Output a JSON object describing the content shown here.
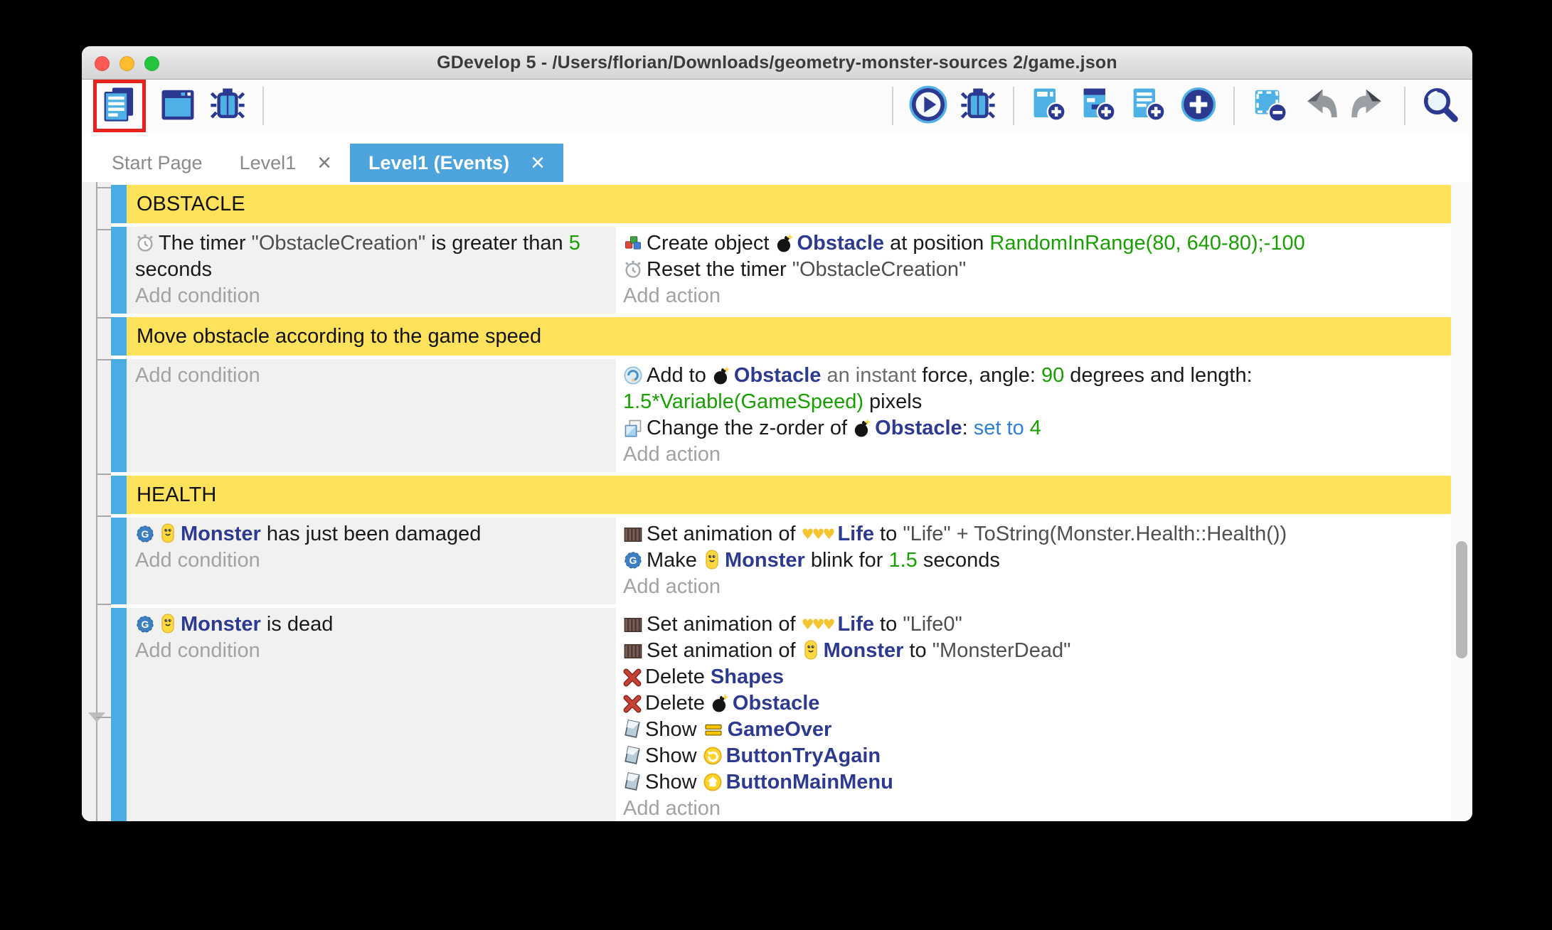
{
  "window": {
    "title": "GDevelop 5 - /Users/florian/Downloads/geometry-monster-sources 2/game.json",
    "traffic_lights": [
      "close",
      "minimize",
      "zoom"
    ]
  },
  "palette": {
    "accent_blue": "#4da3dc",
    "selection_bar_blue": "#4bace3",
    "group_header_yellow": "#ffe25c",
    "object_name_blue": "#2d3a8f",
    "expression_green": "#17a000",
    "operator_blue": "#2e7fd6",
    "annotation_highlight_red": "#e8221c"
  },
  "toolbar": {
    "left": [
      {
        "icon": "events-sheet-icon",
        "highlighted": true
      },
      {
        "icon": "scene-editor-icon"
      },
      {
        "icon": "debug-icon"
      },
      {
        "divider": true
      }
    ],
    "right": [
      {
        "divider": true
      },
      {
        "icon": "play-icon"
      },
      {
        "icon": "debug-icon"
      },
      {
        "divider": true
      },
      {
        "icon": "add-event-icon"
      },
      {
        "icon": "add-subevent-icon"
      },
      {
        "icon": "add-comment-icon"
      },
      {
        "icon": "add-circle-icon"
      },
      {
        "divider": true
      },
      {
        "icon": "remove-selection-icon"
      },
      {
        "icon": "undo-icon"
      },
      {
        "icon": "redo-icon"
      },
      {
        "divider": true
      },
      {
        "icon": "search-icon"
      }
    ]
  },
  "tabs": [
    {
      "label": "Start Page",
      "closable": false,
      "active": false
    },
    {
      "label": "Level1",
      "closable": true,
      "active": false
    },
    {
      "label": "Level1 (Events)",
      "closable": true,
      "active": true
    }
  ],
  "events": {
    "add_condition_label": "Add condition",
    "add_action_label": "Add action",
    "rows": [
      {
        "type": "group",
        "label": "OBSTACLE"
      },
      {
        "type": "event",
        "conditions": [
          {
            "segs": [
              {
                "ic": "timer"
              },
              {
                "t": "The timer ",
                "c": "plain"
              },
              {
                "t": "\"ObstacleCreation\"",
                "c": "string"
              },
              {
                "t": " is greater than ",
                "c": "plain"
              },
              {
                "t": "5",
                "c": "expr"
              },
              {
                "br": true
              },
              {
                "t": "seconds",
                "c": "plain"
              }
            ]
          },
          {
            "ph": "Add condition"
          }
        ],
        "actions": [
          {
            "segs": [
              {
                "ic": "create"
              },
              {
                "t": "Create object ",
                "c": "plain"
              },
              {
                "ic": "bomb"
              },
              {
                "t": "Obstacle",
                "c": "object"
              },
              {
                "t": " at position ",
                "c": "plain"
              },
              {
                "t": "RandomInRange(80, 640-80);-100",
                "c": "expr"
              }
            ]
          },
          {
            "segs": [
              {
                "ic": "timer"
              },
              {
                "t": "Reset the timer ",
                "c": "plain"
              },
              {
                "t": "\"ObstacleCreation\"",
                "c": "string"
              }
            ]
          },
          {
            "ph": "Add action"
          }
        ]
      },
      {
        "type": "group",
        "label": "Move obstacle according to the game speed"
      },
      {
        "type": "event",
        "conditions": [
          {
            "ph": "Add condition"
          }
        ],
        "actions": [
          {
            "segs": [
              {
                "ic": "force"
              },
              {
                "t": "Add to ",
                "c": "plain"
              },
              {
                "ic": "bomb"
              },
              {
                "t": "Obstacle",
                "c": "object"
              },
              {
                "t": " an instant ",
                "c": "gray"
              },
              {
                "t": "force, angle: ",
                "c": "plain"
              },
              {
                "t": "90",
                "c": "expr"
              },
              {
                "t": " degrees and length:",
                "c": "plain"
              },
              {
                "br": true
              },
              {
                "t": "1.5*Variable(GameSpeed)",
                "c": "expr"
              },
              {
                "t": " pixels",
                "c": "plain"
              }
            ]
          },
          {
            "segs": [
              {
                "ic": "zorder"
              },
              {
                "t": "Change the z-order of ",
                "c": "plain"
              },
              {
                "ic": "bomb"
              },
              {
                "t": "Obstacle",
                "c": "object"
              },
              {
                "t": ": ",
                "c": "plain"
              },
              {
                "t": "set to ",
                "c": "blue"
              },
              {
                "t": "4",
                "c": "expr"
              }
            ]
          },
          {
            "ph": "Add action"
          }
        ]
      },
      {
        "type": "group",
        "label": "HEALTH"
      },
      {
        "type": "event",
        "conditions": [
          {
            "segs": [
              {
                "ic": "behavior"
              },
              {
                "ic": "monster"
              },
              {
                "t": "Monster",
                "c": "object"
              },
              {
                "t": " has just been damaged",
                "c": "plain"
              }
            ]
          },
          {
            "ph": "Add condition"
          }
        ],
        "actions": [
          {
            "segs": [
              {
                "ic": "anim"
              },
              {
                "t": "Set animation of ",
                "c": "plain"
              },
              {
                "ic": "hearts"
              },
              {
                "t": "Life",
                "c": "object"
              },
              {
                "t": " to ",
                "c": "plain"
              },
              {
                "t": "\"Life\" + ToString(Monster.Health::Health())",
                "c": "string"
              }
            ]
          },
          {
            "segs": [
              {
                "ic": "behavior"
              },
              {
                "t": "Make ",
                "c": "plain"
              },
              {
                "ic": "monster"
              },
              {
                "t": "Monster",
                "c": "object"
              },
              {
                "t": " blink for ",
                "c": "plain"
              },
              {
                "t": "1.5",
                "c": "expr"
              },
              {
                "t": " seconds",
                "c": "plain"
              }
            ]
          },
          {
            "ph": "Add action"
          }
        ]
      },
      {
        "type": "event",
        "selected": true,
        "conditions": [
          {
            "segs": [
              {
                "ic": "behavior"
              },
              {
                "ic": "monster"
              },
              {
                "t": "Monster",
                "c": "object"
              },
              {
                "t": " is dead",
                "c": "plain"
              }
            ]
          },
          {
            "ph": "Add condition"
          }
        ],
        "actions": [
          {
            "segs": [
              {
                "ic": "anim"
              },
              {
                "t": "Set animation of ",
                "c": "plain"
              },
              {
                "ic": "hearts"
              },
              {
                "t": "Life",
                "c": "object"
              },
              {
                "t": " to ",
                "c": "plain"
              },
              {
                "t": "\"Life0\"",
                "c": "string"
              }
            ]
          },
          {
            "segs": [
              {
                "ic": "anim"
              },
              {
                "t": "Set animation of ",
                "c": "plain"
              },
              {
                "ic": "monster"
              },
              {
                "t": "Monster",
                "c": "object"
              },
              {
                "t": " to ",
                "c": "plain"
              },
              {
                "t": "\"MonsterDead\"",
                "c": "string"
              }
            ]
          },
          {
            "segs": [
              {
                "ic": "delete"
              },
              {
                "t": "Delete ",
                "c": "plain"
              },
              {
                "t": "Shapes",
                "c": "object"
              }
            ]
          },
          {
            "segs": [
              {
                "ic": "delete"
              },
              {
                "t": "Delete ",
                "c": "plain"
              },
              {
                "ic": "bomb"
              },
              {
                "t": "Obstacle",
                "c": "object"
              }
            ]
          },
          {
            "segs": [
              {
                "ic": "show"
              },
              {
                "t": "Show ",
                "c": "plain"
              },
              {
                "ic": "gameover"
              },
              {
                "t": "GameOver",
                "c": "object"
              }
            ]
          },
          {
            "segs": [
              {
                "ic": "show"
              },
              {
                "t": "Show ",
                "c": "plain"
              },
              {
                "ic": "tryagain"
              },
              {
                "t": "ButtonTryAgain",
                "c": "object"
              }
            ]
          },
          {
            "segs": [
              {
                "ic": "show"
              },
              {
                "t": "Show ",
                "c": "plain"
              },
              {
                "ic": "mainmenu"
              },
              {
                "t": "ButtonMainMenu",
                "c": "object"
              }
            ]
          },
          {
            "ph": "Add action"
          }
        ]
      }
    ]
  }
}
